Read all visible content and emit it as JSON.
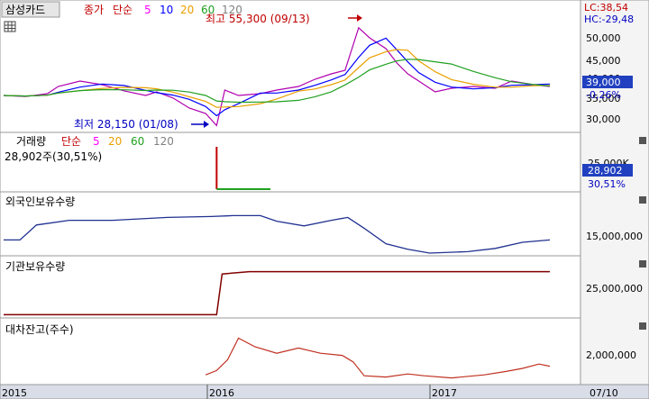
{
  "header": {
    "symbol": "삼성카드",
    "legend_title": "종가",
    "legend_avg": "단순",
    "ma_labels": [
      "5",
      "10",
      "20",
      "60",
      "120"
    ],
    "ma_colors": [
      "#ff00ff",
      "#0000ff",
      "#e8a000",
      "#20a020",
      "#808080"
    ]
  },
  "price_panel": {
    "lc": "LC:38,54",
    "hc": "HC:-29,48",
    "high_annotation": "최고 55,300 (09/13)",
    "low_annotation": "최저 28,150 (01/08)",
    "y_ticks": [
      "50,000",
      "45,000",
      "40,000",
      "35,000",
      "30,000"
    ],
    "last_price": "39,000",
    "last_change": "-0,26%"
  },
  "volume_panel": {
    "title": "거래량",
    "avg_label": "단순",
    "ma_labels": [
      "5",
      "20",
      "60",
      "120"
    ],
    "ma_colors": [
      "#ff00ff",
      "#e8a000",
      "#20a020",
      "#808080"
    ],
    "value_line": "28,902주(30,51%)",
    "y_tick": "25,000K",
    "last_value": "28,902",
    "last_pct": "30,51%"
  },
  "foreign_panel": {
    "title": "외국인보유수량",
    "y_tick": "15,000,000"
  },
  "inst_panel": {
    "title": "기관보유수량",
    "y_tick": "25,000,000"
  },
  "loan_panel": {
    "title": "대차잔고(주수)",
    "y_tick": "2,000,000"
  },
  "x_axis": {
    "labels": [
      "2015",
      "2016",
      "2017",
      "07/10"
    ]
  },
  "chart_data": {
    "type": "line",
    "series": [
      {
        "name": "종가",
        "points": [
          [
            0,
            36500
          ],
          [
            0.04,
            36200
          ],
          [
            0.08,
            37000
          ],
          [
            0.1,
            39000
          ],
          [
            0.14,
            40500
          ],
          [
            0.18,
            39500
          ],
          [
            0.22,
            37800
          ],
          [
            0.26,
            36500
          ],
          [
            0.28,
            37500
          ],
          [
            0.31,
            35800
          ],
          [
            0.34,
            33000
          ],
          [
            0.37,
            31500
          ],
          [
            0.39,
            28150
          ],
          [
            0.405,
            38000
          ],
          [
            0.43,
            36500
          ],
          [
            0.47,
            37000
          ],
          [
            0.5,
            38000
          ],
          [
            0.54,
            39000
          ],
          [
            0.57,
            41000
          ],
          [
            0.6,
            42500
          ],
          [
            0.625,
            43500
          ],
          [
            0.65,
            55300
          ],
          [
            0.67,
            52500
          ],
          [
            0.7,
            49500
          ],
          [
            0.72,
            45500
          ],
          [
            0.74,
            42500
          ],
          [
            0.76,
            40500
          ],
          [
            0.79,
            37500
          ],
          [
            0.82,
            38500
          ],
          [
            0.86,
            39000
          ],
          [
            0.9,
            38500
          ],
          [
            0.93,
            40500
          ],
          [
            0.97,
            39500
          ],
          [
            1.0,
            39000
          ]
        ]
      },
      {
        "name": "외국인보유수량",
        "points": [
          [
            0,
            0.3
          ],
          [
            0.03,
            0.3
          ],
          [
            0.06,
            0.62
          ],
          [
            0.12,
            0.72
          ],
          [
            0.2,
            0.72
          ],
          [
            0.3,
            0.78
          ],
          [
            0.38,
            0.8
          ],
          [
            0.42,
            0.82
          ],
          [
            0.47,
            0.82
          ],
          [
            0.5,
            0.7
          ],
          [
            0.55,
            0.6
          ],
          [
            0.6,
            0.72
          ],
          [
            0.63,
            0.78
          ],
          [
            0.66,
            0.55
          ],
          [
            0.7,
            0.22
          ],
          [
            0.74,
            0.1
          ],
          [
            0.78,
            0.02
          ],
          [
            0.85,
            0.05
          ],
          [
            0.9,
            0.12
          ],
          [
            0.95,
            0.25
          ],
          [
            1.0,
            0.3
          ]
        ]
      },
      {
        "name": "기관보유수량",
        "points": [
          [
            0,
            0.03
          ],
          [
            0.39,
            0.03
          ],
          [
            0.4,
            0.9
          ],
          [
            0.45,
            0.95
          ],
          [
            1.0,
            0.95
          ]
        ]
      },
      {
        "name": "대차잔고(주수)",
        "points": [
          [
            0.37,
            0.1
          ],
          [
            0.39,
            0.2
          ],
          [
            0.41,
            0.45
          ],
          [
            0.43,
            0.95
          ],
          [
            0.46,
            0.75
          ],
          [
            0.5,
            0.6
          ],
          [
            0.54,
            0.72
          ],
          [
            0.58,
            0.6
          ],
          [
            0.62,
            0.55
          ],
          [
            0.64,
            0.4
          ],
          [
            0.66,
            0.08
          ],
          [
            0.7,
            0.05
          ],
          [
            0.74,
            0.12
          ],
          [
            0.77,
            0.08
          ],
          [
            0.82,
            0.03
          ],
          [
            0.88,
            0.1
          ],
          [
            0.92,
            0.18
          ],
          [
            0.95,
            0.25
          ],
          [
            0.98,
            0.35
          ],
          [
            1.0,
            0.3
          ]
        ]
      }
    ],
    "volume": {
      "spike_x": 0.39,
      "spike_value": "28,902"
    }
  }
}
